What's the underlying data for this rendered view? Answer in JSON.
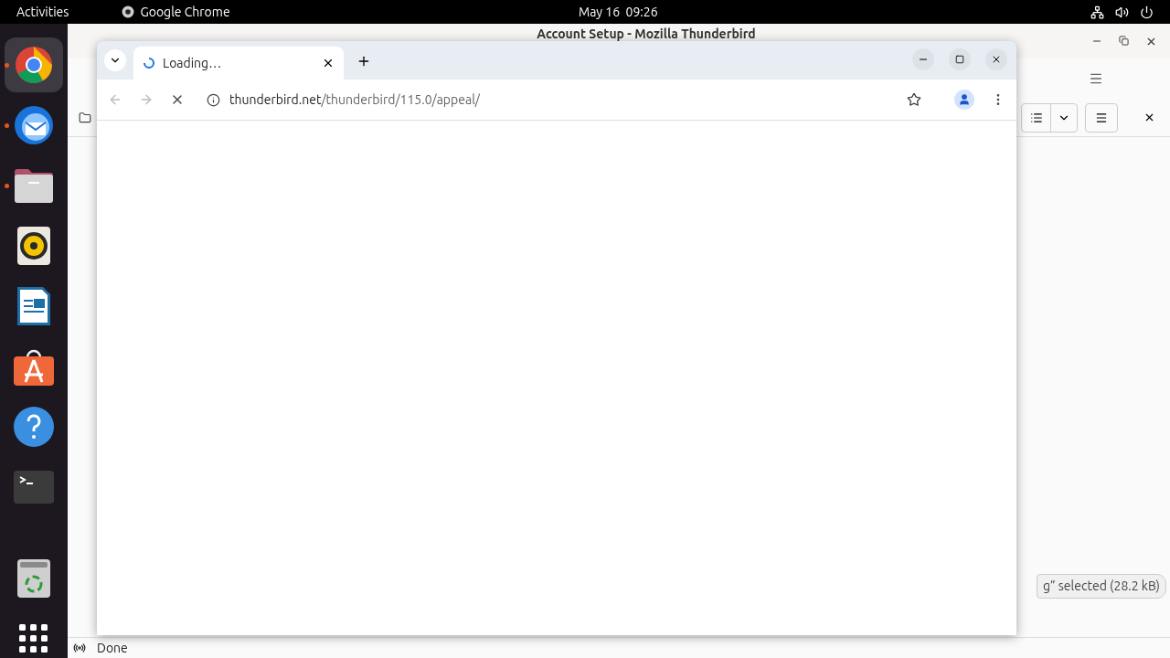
{
  "top_bar": {
    "activities": "Activities",
    "app_name": "Google Chrome",
    "clock": "May 16  09:26"
  },
  "dock": {
    "items": [
      {
        "kind": "chrome",
        "running": true,
        "selected": true
      },
      {
        "kind": "thunderbird",
        "running": true,
        "selected": false
      },
      {
        "kind": "files",
        "running": true,
        "selected": false
      },
      {
        "kind": "rhythmbox",
        "running": false,
        "selected": false
      },
      {
        "kind": "writer",
        "running": false,
        "selected": false
      },
      {
        "kind": "appstore",
        "running": false,
        "selected": false
      },
      {
        "kind": "help",
        "running": false,
        "selected": false
      },
      {
        "kind": "terminal",
        "running": false,
        "selected": false
      },
      {
        "kind": "separator"
      },
      {
        "kind": "trash",
        "running": false,
        "selected": false
      },
      {
        "kind": "apps",
        "running": false,
        "selected": false
      }
    ]
  },
  "thunderbird_window": {
    "title": "Account Setup - Mozilla Thunderbird",
    "notification": "g” selected (28.2 kB)",
    "status": "Done"
  },
  "chrome_window": {
    "tabs": [
      {
        "title": "Loading…",
        "loading": true,
        "selected": true
      }
    ],
    "url_host": "thunderbird.net",
    "url_path": "/thunderbird/115.0/appeal/",
    "loading": true
  }
}
